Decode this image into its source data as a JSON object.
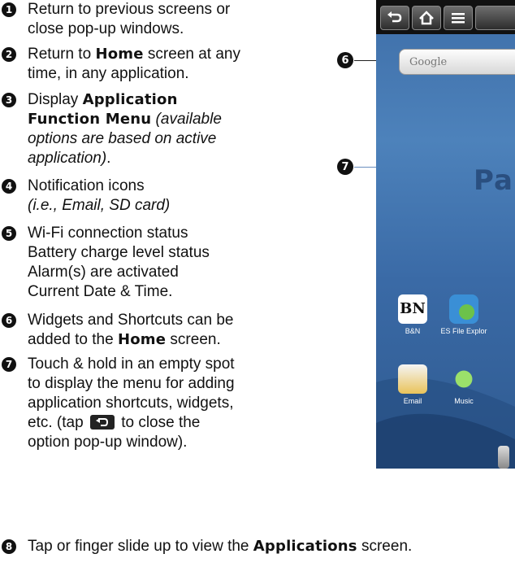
{
  "items": [
    {
      "n": "1",
      "lines": [
        [
          "Return to previous screens or"
        ],
        [
          "close pop-up windows."
        ]
      ]
    },
    {
      "n": "2",
      "lines": [
        [
          "Return to "
        ],
        [
          "time, in any application."
        ]
      ],
      "home": "Home",
      "after": " screen at any"
    },
    {
      "n": "3",
      "display": "Display ",
      "menu1": "Application",
      "menu2": "Function Menu",
      "it1": " (available",
      "it2": "options are based on active",
      "it3": "application)",
      "end": "."
    },
    {
      "n": "4",
      "l1": "Notification icons",
      "l2": "(i.e., Email, SD card)"
    },
    {
      "n": "5",
      "l1": "Wi-Fi connection status",
      "l2": "Battery charge level status",
      "l3": "Alarm(s) are activated",
      "l4": "Current Date & Time."
    },
    {
      "n": "6",
      "l1": "Widgets and Shortcuts can be",
      "l2a": "added to the ",
      "home": "Home",
      "l2b": " screen."
    },
    {
      "n": "7",
      "l1": "Touch & hold in an empty spot",
      "l2": "to display the menu for adding",
      "l3": "application shortcuts, widgets,",
      "l4a": "etc. (tap ",
      "l4b": " to close the",
      "l5": "option pop-up window)."
    },
    {
      "n": "8",
      "a": "Tap or finger slide up to view the ",
      "apps": "Applications",
      "b": " screen."
    }
  ],
  "device": {
    "search_placeholder": "Google",
    "brand": "Pa",
    "apps": [
      {
        "label": "B&N",
        "icon_text": "BN"
      },
      {
        "label": "ES File Explor"
      },
      {
        "label": "Email"
      },
      {
        "label": "Music"
      }
    ],
    "callout6": "6",
    "callout7": "7"
  }
}
